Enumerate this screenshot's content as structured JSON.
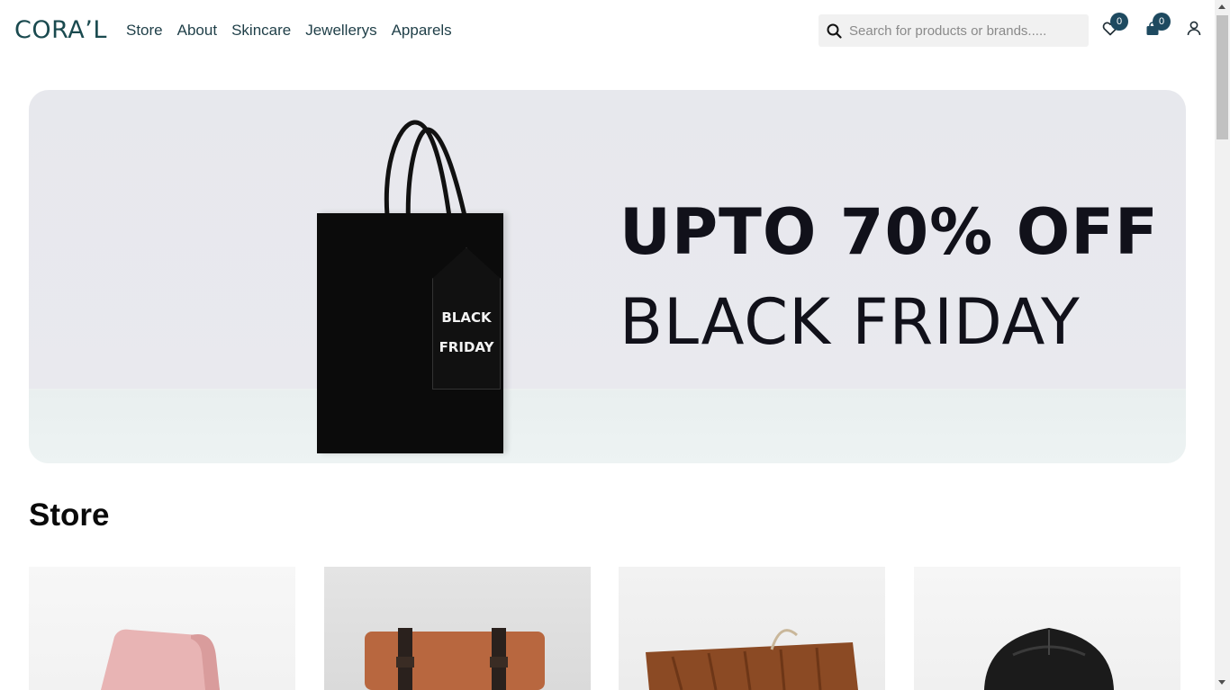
{
  "header": {
    "logo": "CORA’L",
    "nav": [
      "Store",
      "About",
      "Skincare",
      "Jewellerys",
      "Apparels"
    ],
    "search": {
      "placeholder": "Search for products or brands.....",
      "value": ""
    },
    "wishlist_count": "0",
    "cart_count": "0",
    "icons": [
      "search-icon",
      "heart-icon",
      "shopping-bag-icon",
      "user-icon"
    ]
  },
  "hero": {
    "headline_1": "UPTO 70% OFF",
    "headline_2": "BLACK FRIDAY",
    "tag_line_1": "BLACK",
    "tag_line_2": "FRIDAY"
  },
  "store": {
    "title": "Store",
    "products": [
      {
        "image": "pink-bag-image",
        "color": "#e8b4b4"
      },
      {
        "image": "tan-leather-bag-image",
        "color": "#b8673f"
      },
      {
        "image": "brown-woven-bag-image",
        "color": "#8b4a24"
      },
      {
        "image": "black-backpack-image",
        "color": "#1b1b1b"
      }
    ]
  },
  "colors": {
    "accent": "#1e4a60",
    "logo": "#1a4a4f",
    "text": "#1f3f48"
  }
}
